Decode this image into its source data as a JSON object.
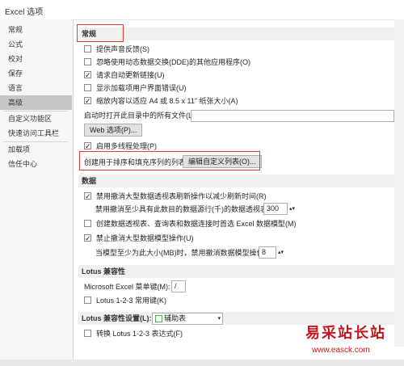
{
  "window": {
    "title": "Excel 选项"
  },
  "sidebar": {
    "items": [
      {
        "label": "常规"
      },
      {
        "label": "公式"
      },
      {
        "label": "校对"
      },
      {
        "label": "保存"
      },
      {
        "label": "语言"
      },
      {
        "label": "高级",
        "active": true
      },
      {
        "label": "自定义功能区"
      },
      {
        "label": "快速访问工具栏"
      },
      {
        "label": "加载项"
      },
      {
        "label": "信任中心"
      }
    ]
  },
  "general": {
    "header": "常规",
    "options": [
      {
        "label": "提供声音反馈(S)",
        "checked": false
      },
      {
        "label": "忽略使用动态数据交换(DDE)的其他应用程序(O)",
        "checked": false
      },
      {
        "label": "请求自动更新链接(U)",
        "checked": true
      },
      {
        "label": "显示加载项用户界面错误(U)",
        "checked": false
      },
      {
        "label": "缩放内容以适应 A4 或 8.5 x 11\" 纸张大小(A)",
        "checked": true
      }
    ],
    "startup_label": "启动时打开此目录中的所有文件(L):",
    "startup_value": "",
    "web_options_button": "Web 选项(P)...",
    "multithread_label": "启用多线程处理(P)",
    "multithread_checked": true,
    "custom_list_label": "创建用于排序和填充序列的列表:",
    "custom_list_button": "编辑自定义列表(O)..."
  },
  "data": {
    "header": "数据",
    "disable_undo_refresh": {
      "label": "禁用撤消大型数据透视表刷新操作以减少刷新时间(R)",
      "checked": true
    },
    "rows_label": "禁用撤消至少具有此数目的数据源行(千)的数据透视表(N):",
    "rows_value": "300",
    "prefer_model": {
      "label": "创建数据透视表、查询表和数据连接时首选 Excel 数据模型(M)",
      "checked": false
    },
    "disable_undo_model": {
      "label": "禁止撤消大型数据模型操作(U)",
      "checked": true
    },
    "model_size_label": "当模型至少为此大小(MB)时，禁用撤消数据模型操作(L):",
    "model_size_value": "8"
  },
  "lotus": {
    "header": "Lotus 兼容性",
    "menu_key_label": "Microsoft Excel 菜单键(M):",
    "menu_key_value": "/",
    "nav_keys": {
      "label": "Lotus 1-2-3 常用键(K)",
      "checked": false
    }
  },
  "lotus_settings": {
    "label": "Lotus 兼容性设置(L):",
    "sheet_value": "辅助表",
    "transition_formula": {
      "label": "转换 Lotus 1-2-3 表达式(F)",
      "checked": false
    }
  },
  "watermark": {
    "text": "易采站长站",
    "url": "www.easck.com"
  },
  "colors": {
    "highlight_box": "#e53935",
    "watermark": "#c4161c"
  }
}
